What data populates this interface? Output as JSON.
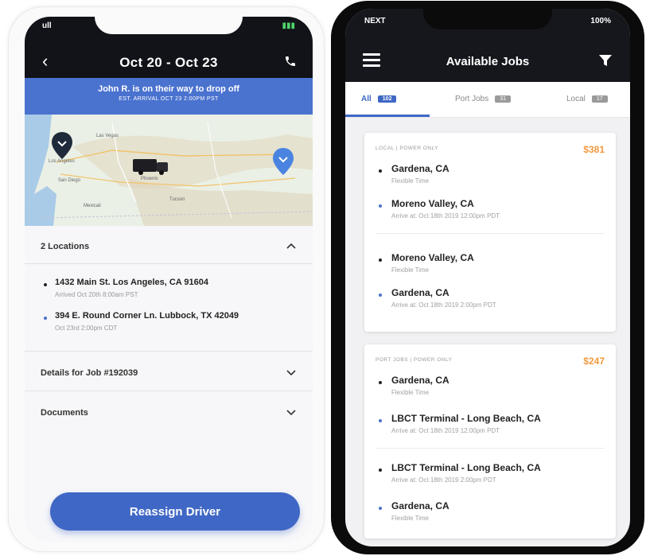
{
  "left_phone": {
    "status": {
      "signal": "ull",
      "battery": "▮▮▮"
    },
    "header": {
      "title": "Oct 20 - Oct 23"
    },
    "banner": {
      "message": "John R. is on their way to drop off",
      "eta": "EST. ARRIVAL OCT 23 2:00PM PST"
    },
    "map": {
      "labels": [
        "Las Vegas",
        "Los Angeles",
        "San Diego",
        "Phoenix",
        "Tucson",
        "Mexicali"
      ]
    },
    "locations": {
      "title": "2 Locations",
      "items": [
        {
          "address": "1432 Main St. Los Angeles, CA 91604",
          "time": "Arrived Oct 20th 8:00am PST",
          "dot_color": "#222222"
        },
        {
          "address": "394 E. Round Corner Ln. Lubbock, TX 42049",
          "time": "Oct 23rd 2:00pm CDT",
          "dot_color": "#4a72cf"
        }
      ]
    },
    "details": {
      "title": "Details for Job #192039"
    },
    "documents": {
      "title": "Documents"
    },
    "action": {
      "label": "Reassign Driver"
    }
  },
  "right_phone": {
    "status": {
      "carrier": "NEXT",
      "battery": "100%"
    },
    "header": {
      "title": "Available Jobs"
    },
    "tabs": [
      {
        "label": "All",
        "count": "102"
      },
      {
        "label": "Port Jobs",
        "count": "31"
      },
      {
        "label": "Local",
        "count": "17"
      }
    ],
    "jobs": [
      {
        "tag": "LOCAL  |  POWER ONLY",
        "price": "$381",
        "stops": [
          {
            "city": "Gardena, CA",
            "time": "Flexible Time",
            "dot_color": "#222222"
          },
          {
            "city": "Moreno Valley, CA",
            "time": "Arrive at: Oct 18th 2019 12:00pm PDT",
            "dot_color": "#4a72cf"
          },
          {
            "city": "Moreno Valley, CA",
            "time": "Flexible Time",
            "dot_color": "#222222"
          },
          {
            "city": "Gardena, CA",
            "time": "Arrive at: Oct 18th 2019 2:00pm PDT",
            "dot_color": "#4a72cf"
          }
        ]
      },
      {
        "tag": "PORT JOBS  |  POWER ONLY",
        "price": "$247",
        "stops": [
          {
            "city": "Gardena, CA",
            "time": "Flexible Time",
            "dot_color": "#222222"
          },
          {
            "city": "LBCT Terminal - Long Beach, CA",
            "time": "Arrive at: Oct 18th 2019 12:00pm PDT",
            "dot_color": "#4a72cf"
          },
          {
            "city": "LBCT Terminal - Long Beach, CA",
            "time": "Arrive at: Oct 18th 2019 2:00pm PDT",
            "dot_color": "#222222"
          },
          {
            "city": "Gardena, CA",
            "time": "Flexible Time",
            "dot_color": "#4a72cf"
          }
        ]
      }
    ]
  },
  "colors": {
    "accent": "#3f67c5",
    "banner": "#4a72cf",
    "price": "#f19a3e",
    "header": "#111318"
  }
}
